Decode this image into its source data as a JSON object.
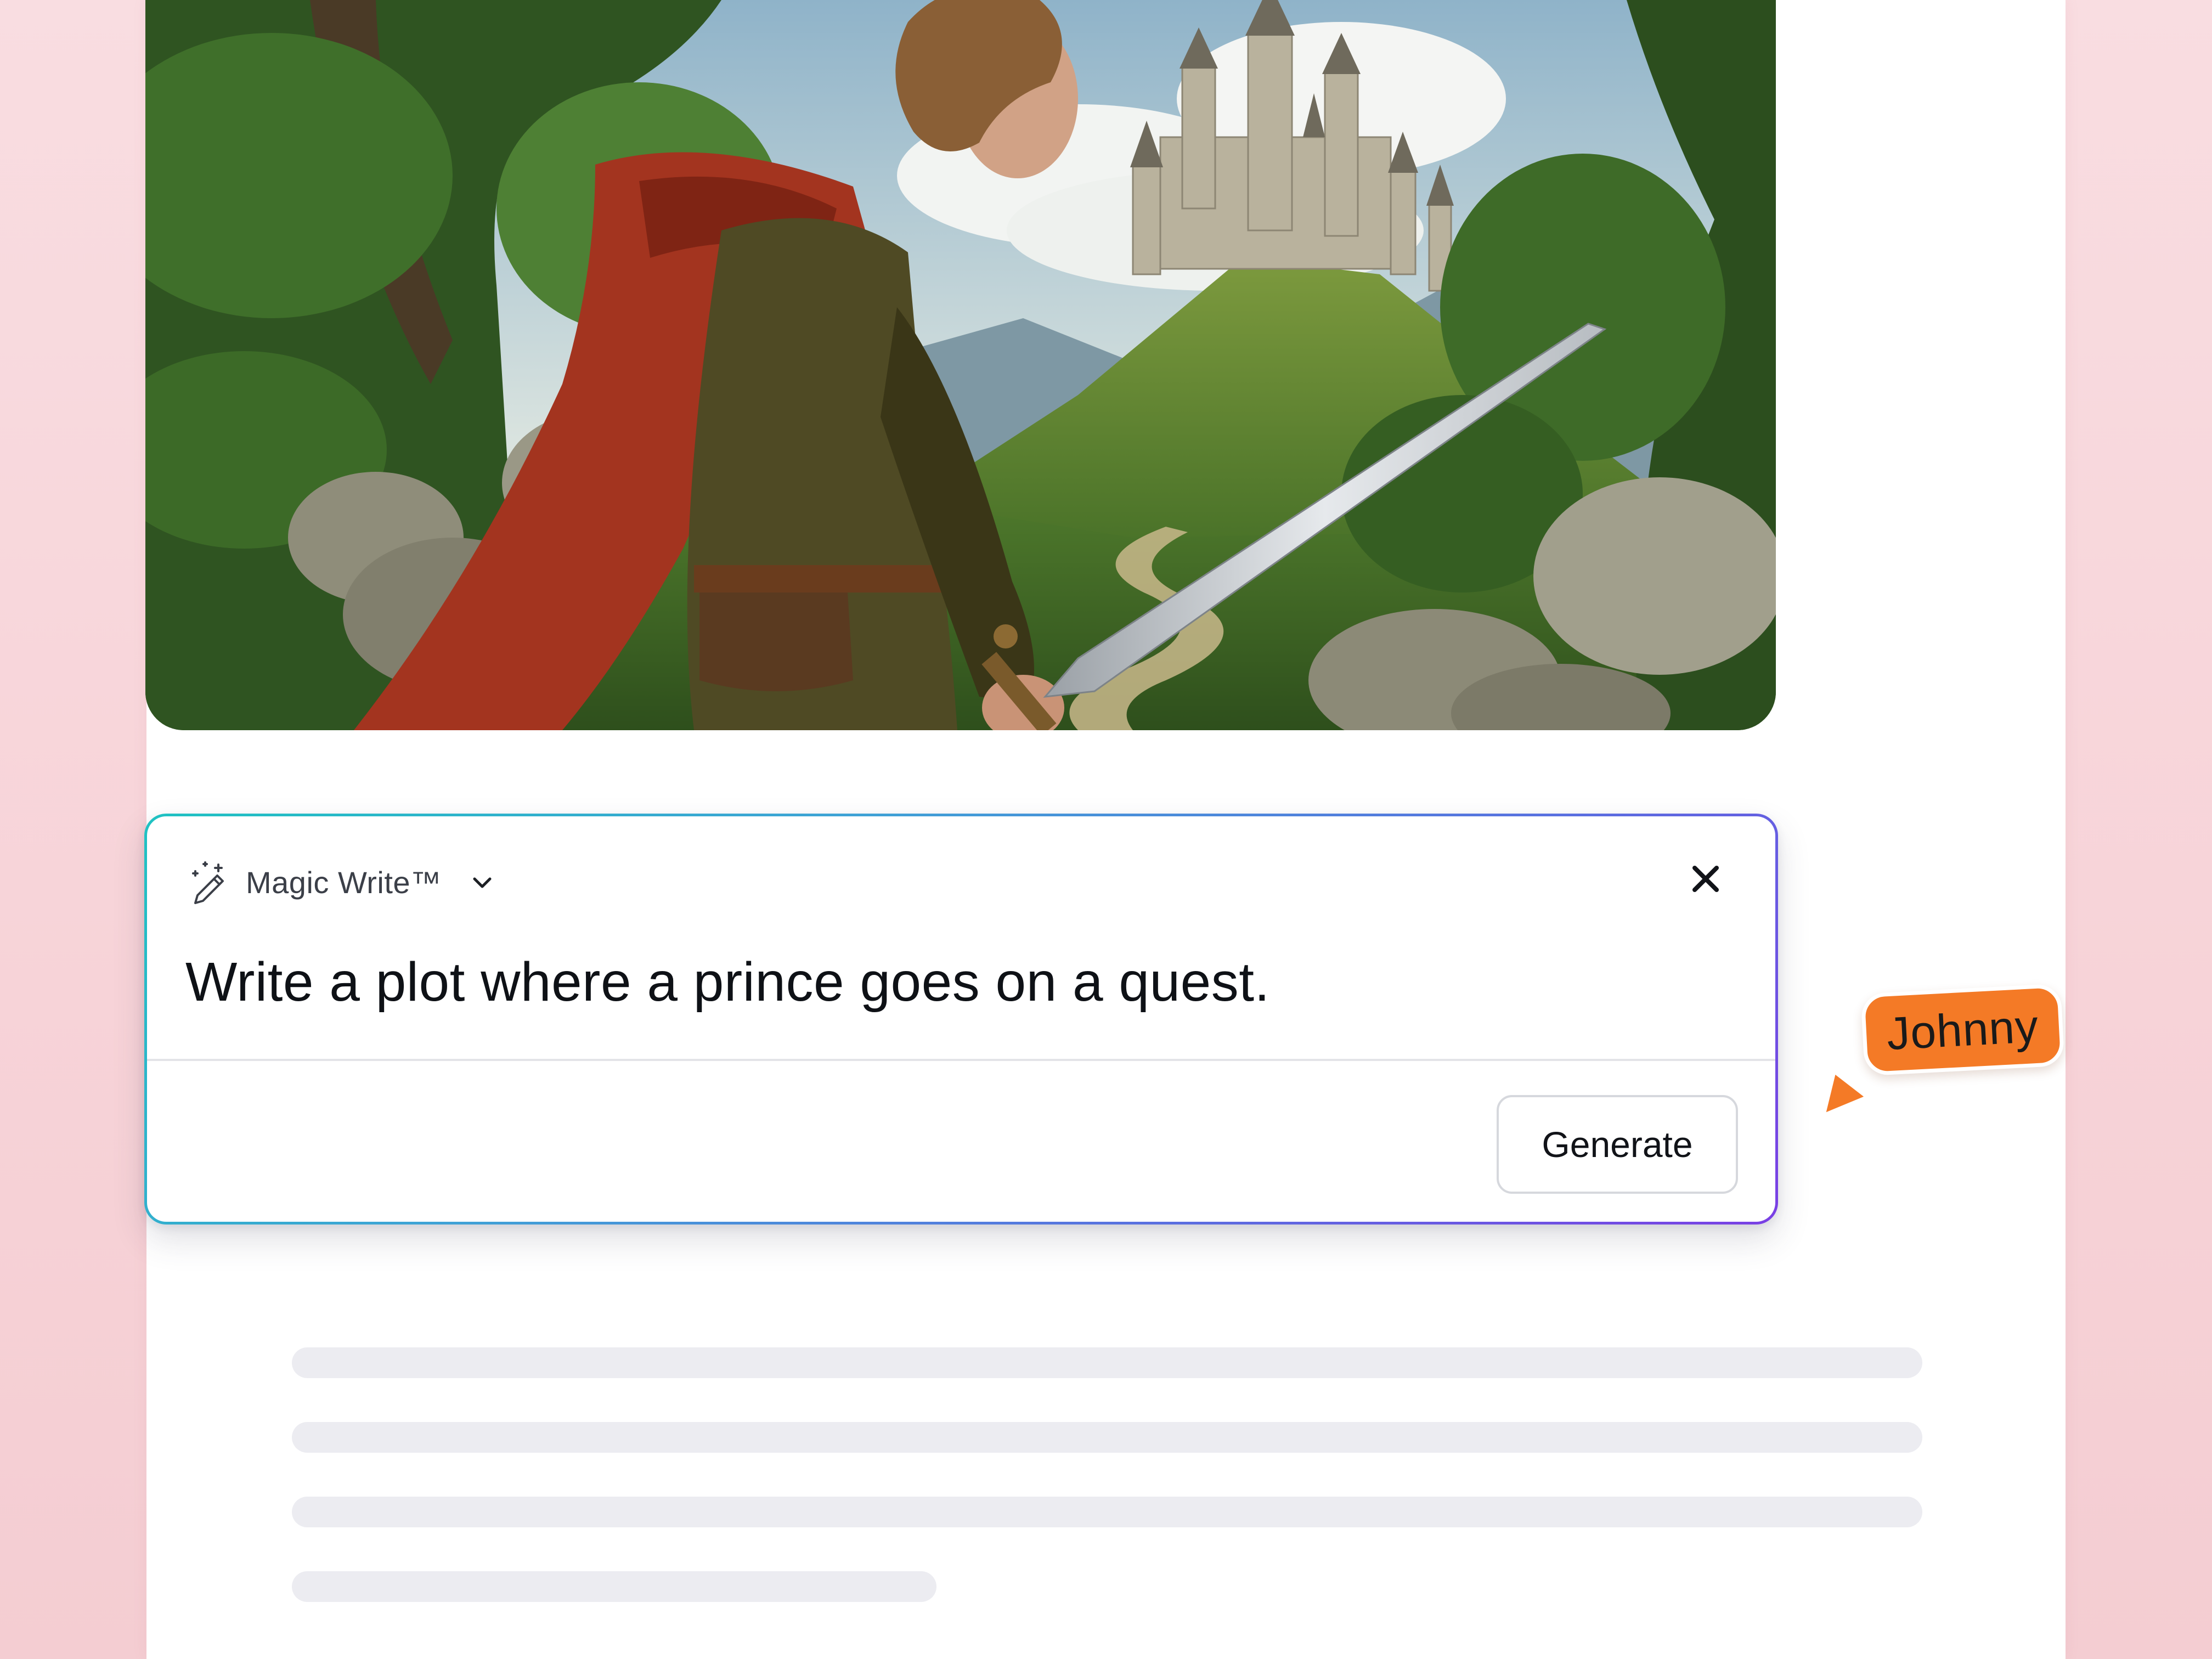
{
  "panel": {
    "tool_name": "Magic Write™",
    "prompt": "Write a plot where a prince goes on a quest.",
    "generate_label": "Generate",
    "icons": {
      "tool": "magic-wand-pencil-icon",
      "dropdown": "chevron-down-icon",
      "close": "close-icon"
    }
  },
  "collaborator": {
    "name": "Johnny",
    "color": "#f47a26"
  },
  "image": {
    "subject": "illustration"
  },
  "colors": {
    "panel_gradient_start": "#1fc2c2",
    "panel_gradient_end": "#7a3fe4",
    "skeleton": "#ececf1"
  }
}
